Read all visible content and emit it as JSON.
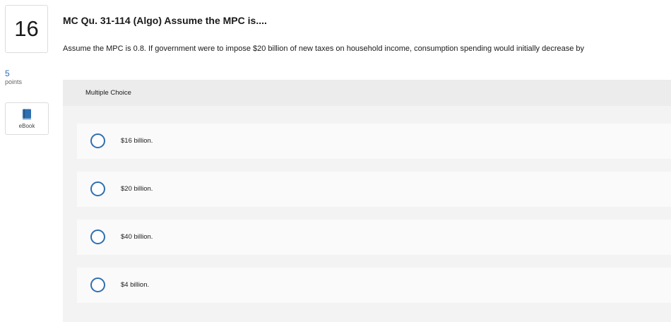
{
  "question": {
    "number": "16",
    "points_value": "5",
    "points_label": "points",
    "ebook_label": "eBook",
    "title": "MC Qu. 31-114 (Algo) Assume the MPC is....",
    "text": "Assume the MPC is 0.8. If government were to impose $20 billion of new taxes on household income, consumption spending would initially decrease by"
  },
  "multiple_choice": {
    "header": "Multiple Choice",
    "options": [
      {
        "label": "$16 billion."
      },
      {
        "label": "$20 billion."
      },
      {
        "label": "$40 billion."
      },
      {
        "label": "$4 billion."
      }
    ]
  },
  "colors": {
    "accent": "#2f6fb0",
    "panel_bg": "#f3f3f3",
    "option_bg": "#fafafa"
  },
  "icons": {
    "ebook": "book-icon"
  }
}
